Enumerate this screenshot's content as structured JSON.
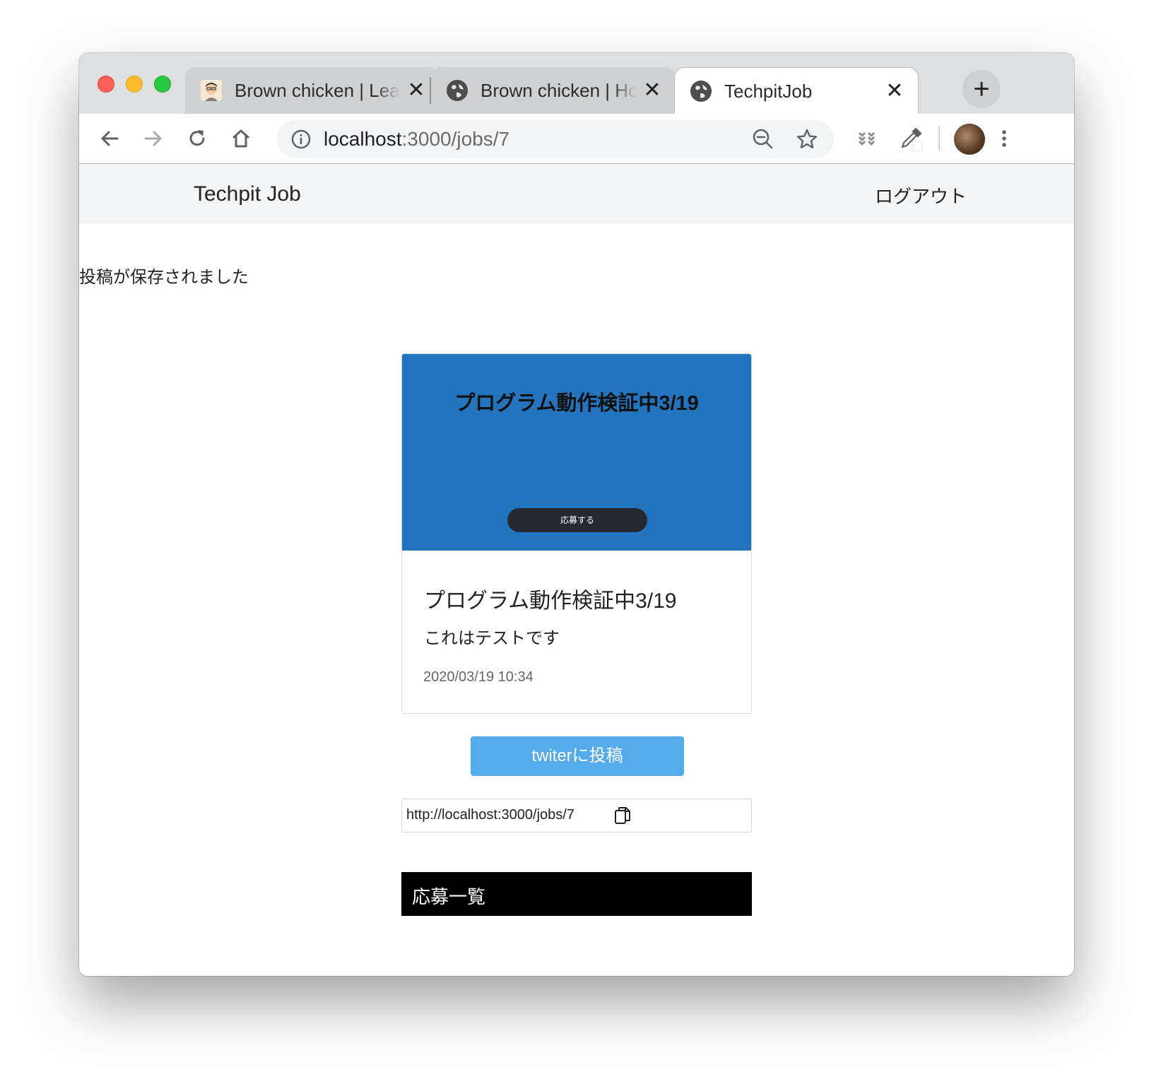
{
  "browser": {
    "tabs": [
      {
        "label": "Brown chicken | Lear",
        "icon": "avatar-favicon"
      },
      {
        "label": "Brown chicken | Hom",
        "icon": "globe-icon"
      },
      {
        "label": "TechpitJob",
        "icon": "globe-icon"
      }
    ],
    "close_glyph": "✕",
    "new_tab_glyph": "+",
    "url": {
      "host": "localhost",
      "path": ":3000/jobs/7"
    }
  },
  "site": {
    "brand": "Techpit Job",
    "logout_label": "ログアウト",
    "flash_message": "投稿が保存されました"
  },
  "job_card": {
    "image": {
      "title": "プログラム動作検証中3/19",
      "apply_label": "応募する",
      "background_color": "#2473bd"
    },
    "title": "プログラム動作検証中3/19",
    "description": "これはテストです",
    "date": "2020/03/19 10:34"
  },
  "share": {
    "tweet_label": "twiterに投稿",
    "url": "http://localhost:3000/jobs/7",
    "tweet_color": "#55aaea"
  },
  "applicants": {
    "heading": "応募一覧"
  }
}
